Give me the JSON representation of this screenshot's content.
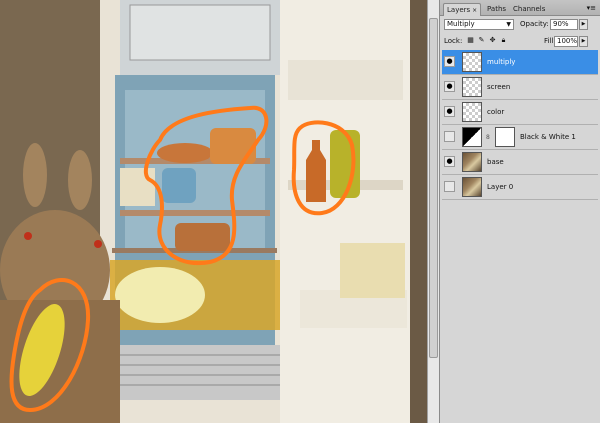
{
  "panel": {
    "tabs": [
      {
        "label": "Layers",
        "close": "×"
      },
      {
        "label": "Paths"
      },
      {
        "label": "Channels"
      }
    ],
    "menu_icon": "panel-menu-icon",
    "blend_mode": "Multiply",
    "opacity_label": "Opacity:",
    "opacity_value": "90%",
    "lock_label": "Lock:",
    "fill_label": "Fill:",
    "fill_value": "100%"
  },
  "layers": [
    {
      "name": "multiply",
      "visible": true,
      "selected": true,
      "thumb": "transparent"
    },
    {
      "name": "screen",
      "visible": true,
      "selected": false,
      "thumb": "transparent"
    },
    {
      "name": "color",
      "visible": true,
      "selected": false,
      "thumb": "transparent"
    },
    {
      "name": "Black & White 1",
      "visible": false,
      "selected": false,
      "thumb": "adjustment"
    },
    {
      "name": "base",
      "visible": true,
      "selected": false,
      "thumb": "photo"
    },
    {
      "name": "Layer 0",
      "visible": false,
      "selected": false,
      "thumb": "photo"
    }
  ],
  "colors": {
    "selection": "#3a8ee6",
    "annotation_stroke": "#ff7a1a",
    "panel_bg": "#d6d6d6"
  }
}
